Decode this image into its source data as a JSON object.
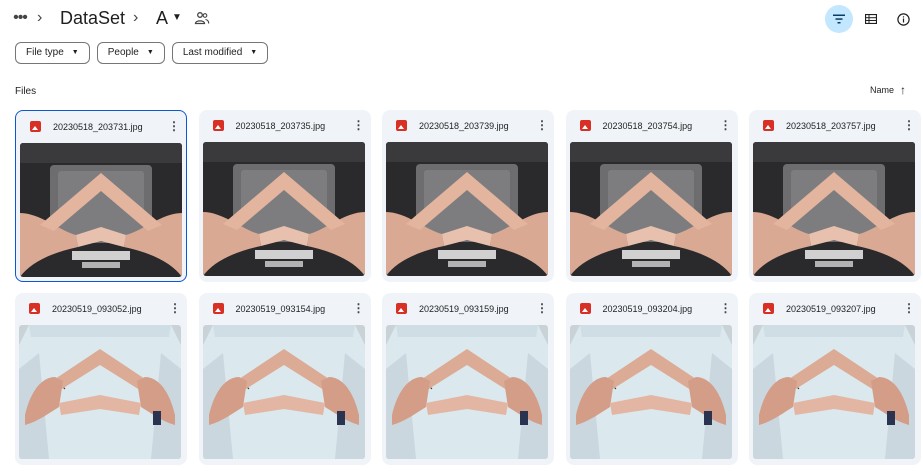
{
  "breadcrumb": {
    "more": "•••",
    "parent": "DataSet",
    "current": "A"
  },
  "filters": [
    {
      "label": "File type"
    },
    {
      "label": "People"
    },
    {
      "label": "Last modified"
    }
  ],
  "section_label": "Files",
  "sort": {
    "label": "Name",
    "direction": "ascending"
  },
  "files": [
    {
      "name": "20230518_203731.jpg",
      "selected": true,
      "scene": "dark"
    },
    {
      "name": "20230518_203735.jpg",
      "selected": false,
      "scene": "dark"
    },
    {
      "name": "20230518_203739.jpg",
      "selected": false,
      "scene": "dark"
    },
    {
      "name": "20230518_203754.jpg",
      "selected": false,
      "scene": "dark"
    },
    {
      "name": "20230518_203757.jpg",
      "selected": false,
      "scene": "dark"
    },
    {
      "name": "20230519_093052.jpg",
      "selected": false,
      "scene": "light"
    },
    {
      "name": "20230519_093154.jpg",
      "selected": false,
      "scene": "light"
    },
    {
      "name": "20230519_093159.jpg",
      "selected": false,
      "scene": "light"
    },
    {
      "name": "20230519_093204.jpg",
      "selected": false,
      "scene": "light"
    },
    {
      "name": "20230519_093207.jpg",
      "selected": false,
      "scene": "light"
    }
  ],
  "colors": {
    "accent": "#0b57d0",
    "active_toggle": "#c2e7ff",
    "card_bg": "#f0f4f9",
    "image_icon": "#d93025"
  }
}
